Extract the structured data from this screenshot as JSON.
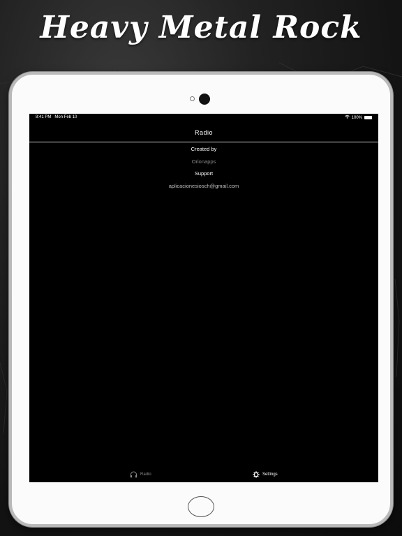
{
  "headline": "Heavy Metal Rock",
  "status": {
    "time": "8:41 PM",
    "date": "Mon Feb 10",
    "battery": "100%"
  },
  "nav": {
    "title": "Radio"
  },
  "settings": {
    "created_by_label": "Created by",
    "creator": "Orionapps",
    "support_label": "Support",
    "support_email": "aplicacionesiosch@gmail.com"
  },
  "tabs": [
    {
      "label": "Radio",
      "icon": "headphones-icon",
      "active": false
    },
    {
      "label": "Settings",
      "icon": "gear-icon",
      "active": true
    }
  ],
  "colors": {
    "background": "#000000",
    "active_tab": "#ffffff",
    "inactive_tab": "#8a8a8a"
  }
}
